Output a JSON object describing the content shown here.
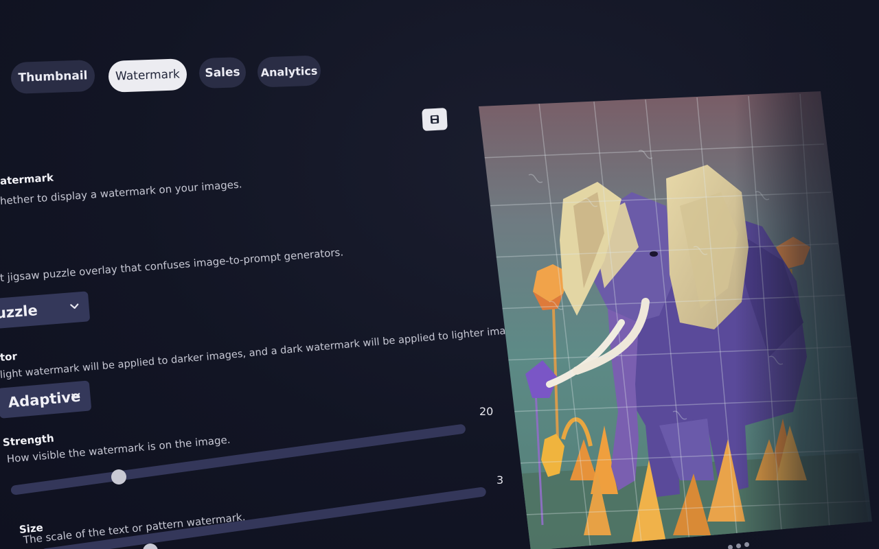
{
  "tabs": [
    {
      "label": "Thumbnail",
      "active": false
    },
    {
      "label": "Watermark",
      "active": true
    },
    {
      "label": "Sales",
      "active": false
    },
    {
      "label": "Analytics",
      "active": false
    }
  ],
  "settings": {
    "watermark": {
      "label": "atermark",
      "description": "hether to display a watermark on your images."
    },
    "pattern": {
      "description": "t jigsaw puzzle overlay that confuses image-to-prompt generators.",
      "selected": "uzzle"
    },
    "color": {
      "label": "tor",
      "description": "light watermark will be applied to darker images, and a dark watermark will be applied to lighter images.",
      "selected": "Adaptive"
    },
    "strength": {
      "label": "Strength",
      "description": "How visible the watermark is on the image.",
      "value": "20",
      "fraction": 0.23
    },
    "size": {
      "label": "Size",
      "description": "The scale of the text or pattern watermark.",
      "value": "3",
      "fraction": 0.3
    }
  },
  "icons": {
    "save": "save-icon",
    "chevron": "chevron-down-icon"
  },
  "colors": {
    "background": "#121524",
    "tab_inactive": "#2a2d45",
    "tab_active": "#ececf1",
    "select_bg": "#34385a",
    "slider_track": "#34375a",
    "slider_knob": "#c9c9d4"
  }
}
